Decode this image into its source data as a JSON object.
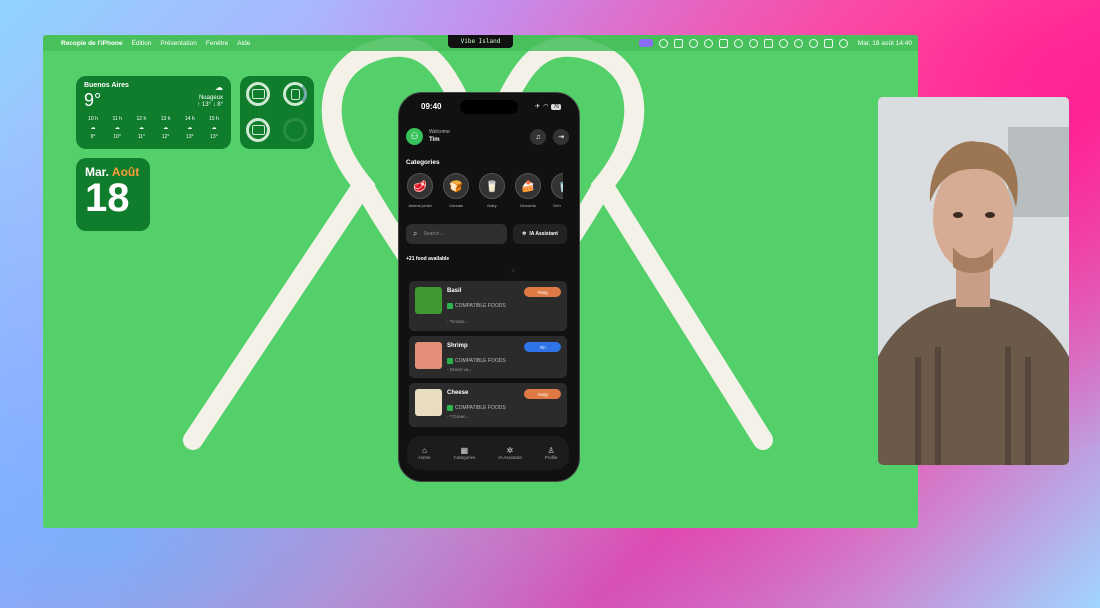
{
  "menubar": {
    "app_name": "Recopie de l'iPhone",
    "menus": [
      "Édition",
      "Présentation",
      "Fenêtre",
      "Aide"
    ],
    "notch_label": "Vibe Island",
    "clock": "Mar. 18 août 14:40"
  },
  "weather": {
    "city": "Buenos Aires",
    "temp": "9°",
    "condition": "Nuageux",
    "hilo": "↑ 13° ↓ 8°",
    "hours": [
      {
        "h": "10 h",
        "t": "9°"
      },
      {
        "h": "11 h",
        "t": "10°"
      },
      {
        "h": "12 h",
        "t": "11°"
      },
      {
        "h": "13 h",
        "t": "12°"
      },
      {
        "h": "14 h",
        "t": "13°"
      },
      {
        "h": "15 h",
        "t": "13°"
      }
    ]
  },
  "calendar": {
    "weekday": "Mar.",
    "month": "Août",
    "day": "18"
  },
  "phone": {
    "time": "09:40",
    "battery": "76",
    "welcome": "Welcome",
    "user": "Tim",
    "categories_title": "Categories",
    "categories": [
      {
        "label": "Animal protei",
        "icon": "🥩"
      },
      {
        "label": "Cereals",
        "icon": "🍞"
      },
      {
        "label": "Dairy",
        "icon": "🥛"
      },
      {
        "label": "Desserts",
        "icon": "🍰"
      },
      {
        "label": "Drin",
        "icon": "🥤"
      }
    ],
    "search_placeholder": "Search...",
    "ia_button": "IA Assistant",
    "available": "+21 food available",
    "foods": [
      {
        "name": "Basil",
        "compat": "COMPATIBLE FOODS",
        "sub": "- Tomato...",
        "tag": "Yang",
        "tag_color": "#e07a45",
        "img": "#3f9a32"
      },
      {
        "name": "Shrimp",
        "compat": "COMPATIBLE FOODS",
        "sub": "- Green va...",
        "tag": "Yin",
        "tag_color": "#2e74e8",
        "img": "#e58f78"
      },
      {
        "name": "Cheese",
        "compat": "COMPATIBLE FOODS",
        "sub": "- **Green...",
        "tag": "Yang",
        "tag_color": "#e07a45",
        "img": "#e8ddc0"
      }
    ],
    "tabs": [
      {
        "label": "Home",
        "icon": "⌂"
      },
      {
        "label": "Categories",
        "icon": "▦"
      },
      {
        "label": "IA Assistant",
        "icon": "✲"
      },
      {
        "label": "Profile",
        "icon": "♙"
      }
    ]
  },
  "dock_colors": [
    "#3d8ef0",
    "#f2f2f2",
    "#f4f4f4",
    "#f0c04a",
    "#3a7bf0",
    "#e8e8e8",
    "#ffd43b",
    "#b0b0b0",
    "#2a5bd7",
    "#4fbf3a",
    "#f5f5f5",
    "#3ac35d",
    "#e24a3b",
    "#f5f5f5",
    "#3a7bf0",
    "#3ac35d",
    "#32a852",
    "#1d8cf0",
    "#666666",
    "#333333",
    "#7c6cf0",
    "#222222",
    "#5865f2",
    "#1677ff",
    "#25d366",
    "#0a66c2",
    "#8b5cf6",
    "#e34234",
    "#1e1e1e",
    "#111111",
    "#0d8bff",
    "#f5f5f5",
    "#8e44ad",
    "#1f73e0",
    "#4fbf3a",
    "#5ab0f0",
    "#5ab0f0",
    "#cccccc"
  ]
}
